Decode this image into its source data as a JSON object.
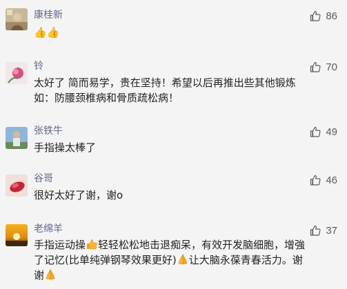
{
  "comments": [
    {
      "name": "康桂新",
      "likes": "86",
      "lines": [
        "👍👍"
      ]
    },
    {
      "name": "铃",
      "likes": "70",
      "lines": [
        "太好了 简而易学，贵在坚持！希望以后再推出些其他锻炼",
        "如：防腰颈椎病和骨质疏松病！"
      ]
    },
    {
      "name": "张铁牛",
      "likes": "49",
      "lines": [
        "手指操太棒了"
      ]
    },
    {
      "name": "谷哥",
      "likes": "46",
      "lines": [
        "很好太好了谢，谢o"
      ]
    },
    {
      "name": "老绵羊",
      "likes": "37",
      "line1_a": "手指运动操",
      "line1_b": "轻轻松松地击退痴呆，有效开发脑细胞，增強",
      "line2_a": "了记忆(比单纯弹钢琴效果更好)",
      "line2_b": "让大脑永葆青春活力。谢",
      "line3_a": "谢"
    }
  ],
  "colors": {
    "name": "#5a6a8a",
    "text": "#222222",
    "background": "#f4f4f4"
  }
}
